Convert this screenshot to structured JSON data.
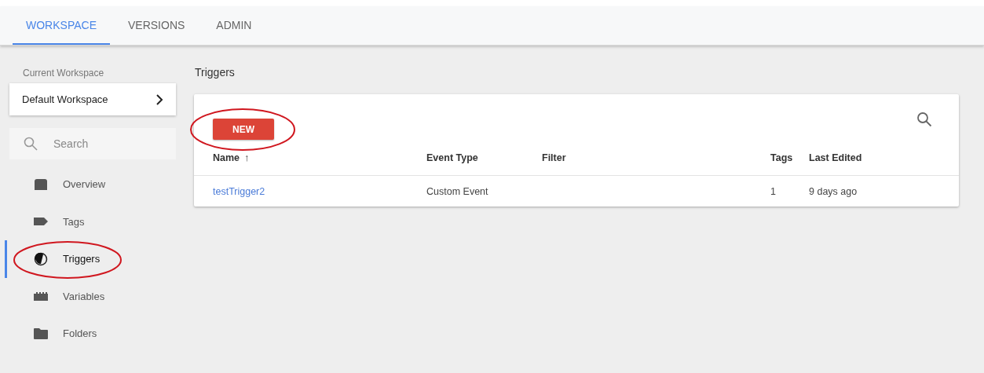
{
  "tabs": [
    {
      "label": "WORKSPACE",
      "selected": true
    },
    {
      "label": "VERSIONS",
      "selected": false
    },
    {
      "label": "ADMIN",
      "selected": false
    }
  ],
  "sidebar": {
    "workspace_label": "Current Workspace",
    "workspace": "Default Workspace",
    "search": {
      "placeholder": "Search"
    },
    "items": [
      {
        "label": "Overview",
        "selected": false,
        "circled": false
      },
      {
        "label": "Tags",
        "selected": false,
        "circled": false
      },
      {
        "label": "Triggers",
        "selected": true,
        "circled": true
      },
      {
        "label": "Variables",
        "selected": false,
        "circled": false
      },
      {
        "label": "Folders",
        "selected": false,
        "circled": false
      }
    ]
  },
  "page_title": "Triggers",
  "new_button": {
    "label": "NEW",
    "circled": true
  },
  "table": {
    "columns": [
      {
        "label": "Name",
        "sorted": true
      },
      {
        "label": "Event Type",
        "sorted": false
      },
      {
        "label": "Filter",
        "sorted": false
      },
      {
        "label": "Tags",
        "sorted": false
      },
      {
        "label": "Last Edited",
        "sorted": false
      }
    ],
    "sort_mark": "↑",
    "rows": [
      {
        "cells": [
          "testTrigger2",
          "Custom Event",
          "",
          "1",
          "9 days ago"
        ]
      }
    ]
  }
}
